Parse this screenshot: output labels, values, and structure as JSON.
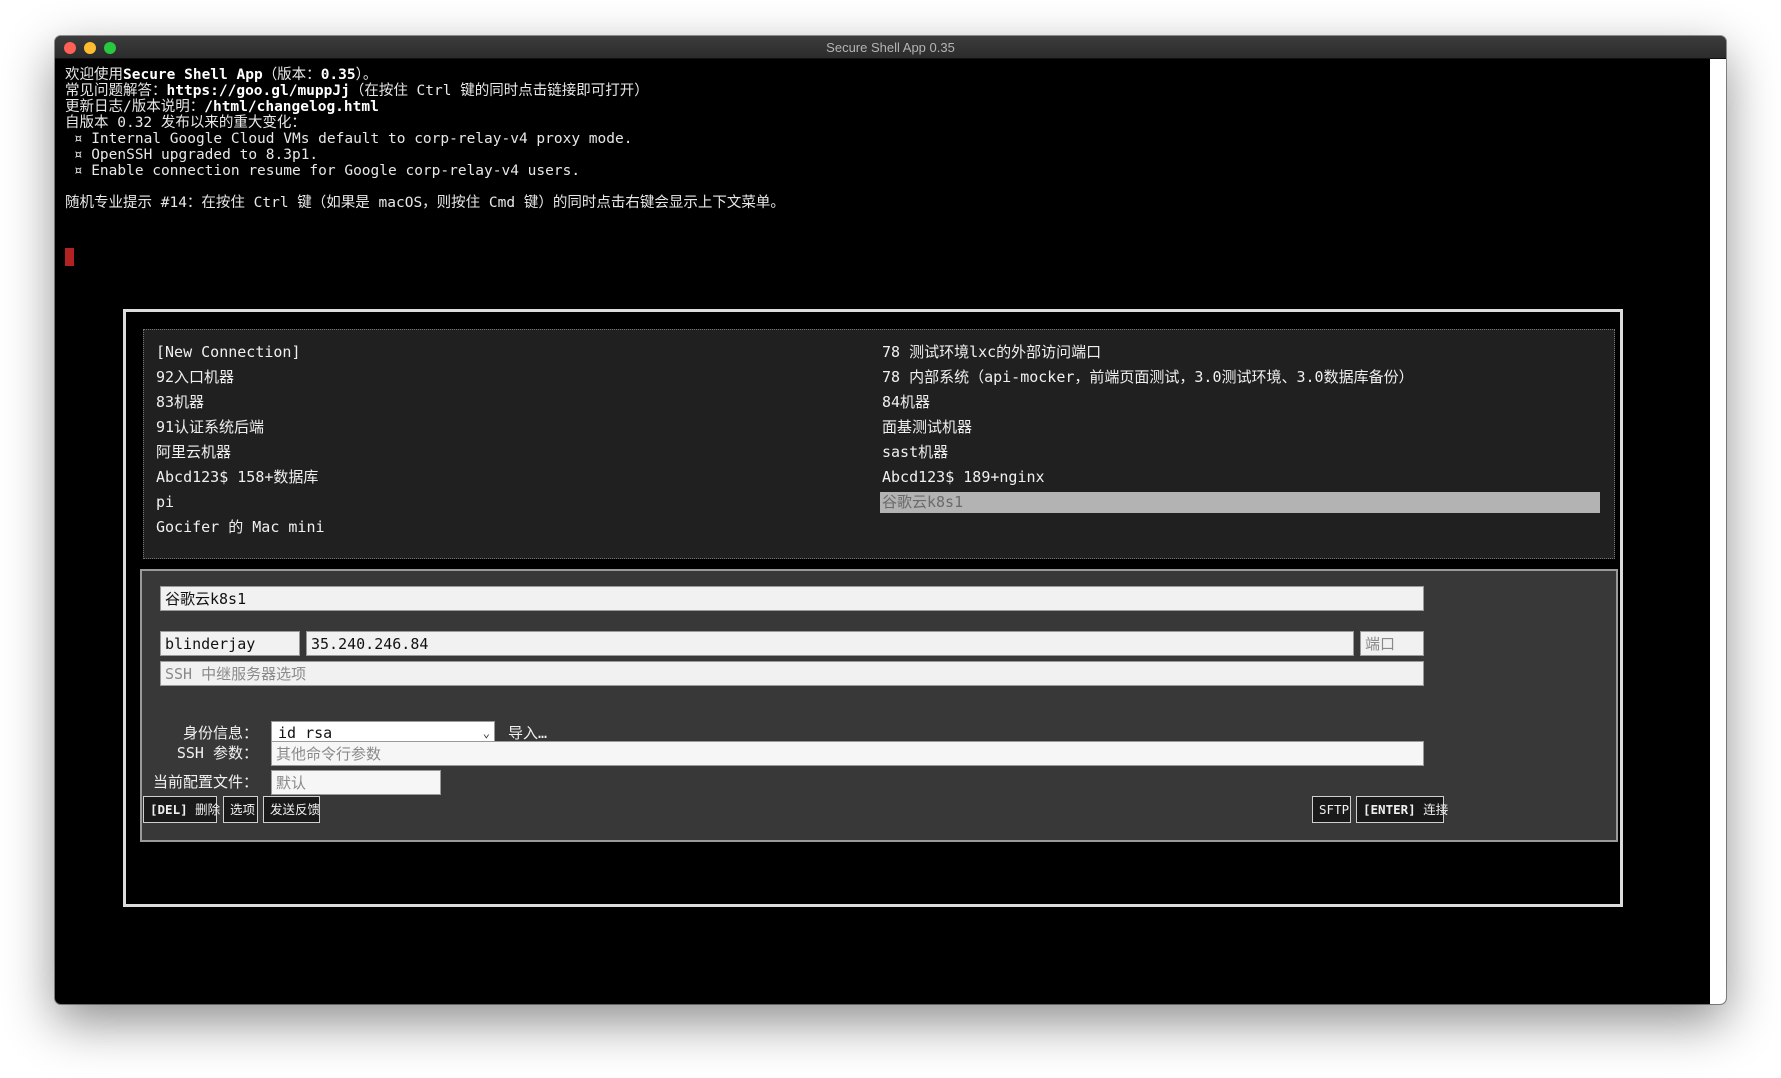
{
  "window": {
    "title": "Secure Shell App 0.35"
  },
  "terminal": {
    "lines": [
      [
        {
          "t": "欢迎使用"
        },
        {
          "t": "Secure Shell App",
          "b": true
        },
        {
          "t": "（版本："
        },
        {
          "t": "0.35",
          "b": true
        },
        {
          "t": "）。"
        }
      ],
      [
        {
          "t": "常见问题解答："
        },
        {
          "t": "https://goo.gl/muppJj",
          "b": true
        },
        {
          "t": "（在按住 Ctrl 键的同时点击链接即可打开）"
        }
      ],
      [
        {
          "t": "更新日志/版本说明："
        },
        {
          "t": "/html/changelog.html",
          "b": true
        }
      ],
      [
        {
          "t": "自版本 0.32 发布以来的重大变化："
        }
      ],
      [
        {
          "t": " ¤ Internal Google Cloud VMs default to corp-relay-v4 proxy mode."
        }
      ],
      [
        {
          "t": " ¤ OpenSSH upgraded to 8.3p1."
        }
      ],
      [
        {
          "t": " ¤ Enable connection resume for Google corp-relay-v4 users."
        }
      ],
      [
        {
          "t": ""
        }
      ],
      [
        {
          "t": "随机专业提示 #14：在按住 Ctrl 键（如果是 macOS，则按住 Cmd 键）的同时点击右键会显示上下文菜单。"
        }
      ]
    ]
  },
  "connections": {
    "left": [
      "[New Connection]",
      "92入口机器",
      "83机器",
      "91认证系统后端",
      "阿里云机器",
      "Abcd123$ 158+数据库",
      "pi",
      "Gocifer 的 Mac mini"
    ],
    "right": [
      "78 测试环境lxc的外部访问端口",
      "78 内部系统（api-mocker，前端页面测试，3.0测试环境、3.0数据库备份）",
      "84机器",
      "面基测试机器",
      "sast机器",
      "Abcd123$ 189+nginx",
      "谷歌云k8s1"
    ],
    "selected": "谷歌云k8s1"
  },
  "form": {
    "description": "谷歌云k8s1",
    "username": "blinderjay",
    "hostname": "35.240.246.84",
    "port_placeholder": "端口",
    "relay_placeholder": "SSH 中继服务器选项",
    "identity_label": "身份信息：",
    "identity_value": "id_rsa",
    "import_label": "导入…",
    "ssh_args_label": "SSH 参数：",
    "ssh_args_placeholder": "其他命令行参数",
    "profile_label": "当前配置文件：",
    "profile_placeholder": "默认"
  },
  "buttons": {
    "delete_key": "[DEL]",
    "delete_label": "删除",
    "options": "选项",
    "feedback": "发送反馈",
    "sftp": "SFTP",
    "connect_key": "[ENTER]",
    "connect_label": "连接"
  }
}
